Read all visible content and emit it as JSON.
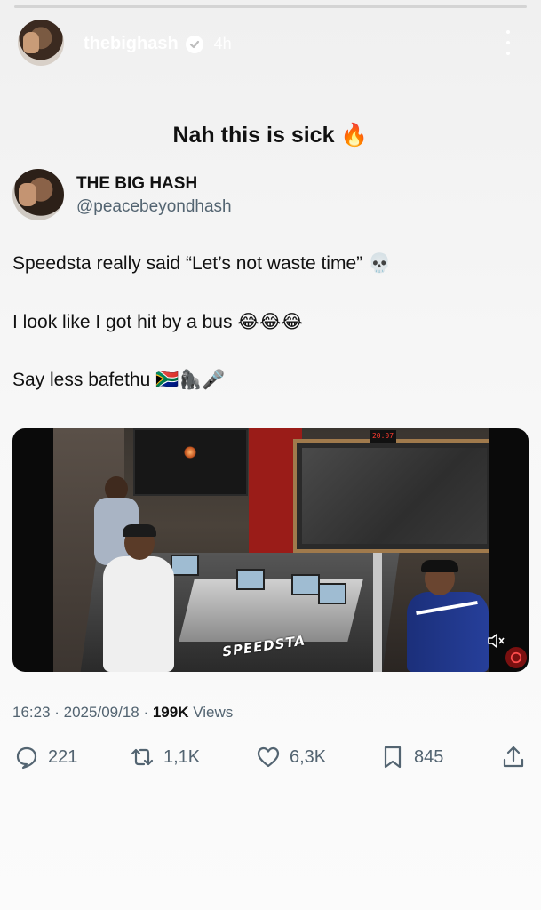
{
  "story": {
    "username": "thebighash",
    "time_ago": "4h",
    "caption": "Nah this is sick 🔥"
  },
  "tweet": {
    "author_name": "THE BIG HASH",
    "author_handle": "@peacebeyondhash",
    "lines": [
      "Speedsta really said “Let’s not waste time” 💀",
      "I look like I got hit by a bus 😂😂😂",
      "Say less bafethu 🇿🇦🦍🎤"
    ],
    "video": {
      "watermark": "SPEEDSTA",
      "clock_text": "20:07",
      "muted": true
    },
    "timestamp": "16:23 · 2025/09/18 · ",
    "views_count": "199K",
    "views_label": " Views",
    "actions": {
      "replies": "221",
      "reposts": "1,1K",
      "likes": "6,3K",
      "bookmarks": "845"
    }
  },
  "colors": {
    "text": "#0f1419",
    "muted": "#536471",
    "background": "#f5f5f5"
  },
  "icons": [
    "verified-badge-icon",
    "more-vertical-icon",
    "reply-icon",
    "repost-icon",
    "like-icon",
    "bookmark-icon",
    "share-icon",
    "mute-icon",
    "skull-emoji",
    "laugh-emoji",
    "fire-emoji",
    "flag-za-emoji",
    "gorilla-emoji",
    "microphone-emoji"
  ]
}
